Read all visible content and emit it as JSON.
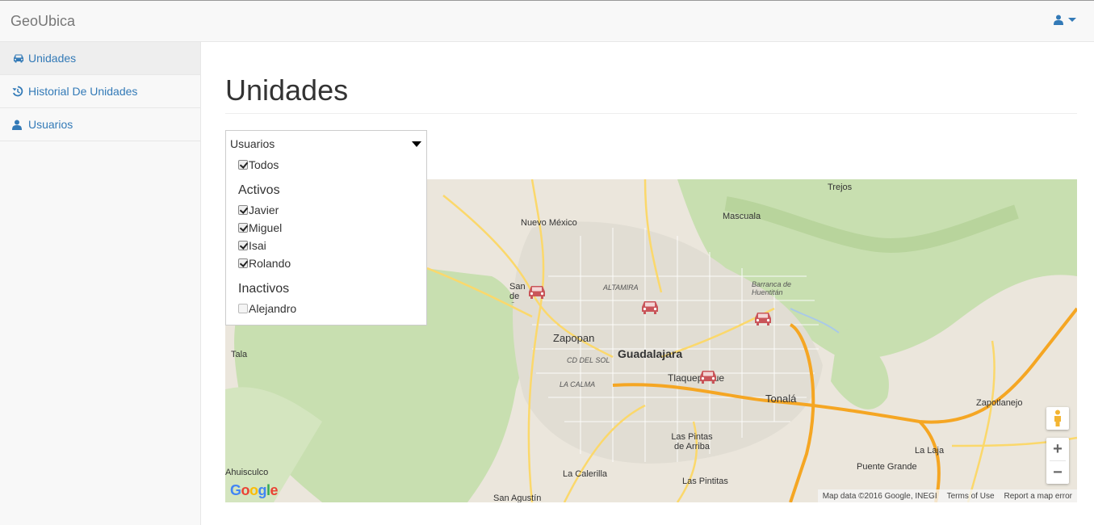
{
  "app": {
    "brand": "GeoUbica"
  },
  "sidebar": {
    "items": [
      {
        "label": "Unidades",
        "icon": "car-icon",
        "active": true
      },
      {
        "label": "Historial De Unidades",
        "icon": "history-icon",
        "active": false
      },
      {
        "label": "Usuarios",
        "icon": "user-icon",
        "active": false
      }
    ]
  },
  "page": {
    "title": "Unidades"
  },
  "filter": {
    "header": "Usuarios",
    "all": {
      "label": "Todos",
      "checked": true
    },
    "active_group": "Activos",
    "active_users": [
      {
        "label": "Javier",
        "checked": true
      },
      {
        "label": "Miguel",
        "checked": true
      },
      {
        "label": "Isai",
        "checked": true
      },
      {
        "label": "Rolando",
        "checked": true
      }
    ],
    "inactive_group": "Inactivos",
    "inactive_users": [
      {
        "label": "Alejandro",
        "checked": false
      }
    ]
  },
  "map": {
    "places": {
      "guadalajara": "Guadalajara",
      "zapopan": "Zapopan",
      "tonala": "Tonalá",
      "tlaquepaque": "Tlaquepaque",
      "nuevo_mexico": "Nuevo México",
      "mascuala": "Mascuala",
      "trejos": "Trejos",
      "barranca": "Barranca de Huentitán",
      "tala": "Tala",
      "ahuisculco": "Ahuisculco",
      "la_calerilla": "La Calerilla",
      "las_pintitas": "Las Pintitas",
      "las_pintas_de_arriba": "Las Pintas de Arriba",
      "san_agustin": "San Agustín",
      "puente_grande": "Puente Grande",
      "la_laja": "La Laja",
      "zapotlanejo": "Zapotlanejo",
      "cd_del_sol": "CD DEL SOL",
      "la_calma": "LA CALMA",
      "altamira": "ALTAMIRA",
      "san_cristobal": "San de C..."
    },
    "attribution": "Map data ©2016 Google, INEGI",
    "terms": "Terms of Use",
    "report": "Report a map error",
    "google_logo": "Google",
    "zoom_in": "+",
    "zoom_out": "−",
    "markers": [
      "car-marker-1",
      "car-marker-2",
      "car-marker-3",
      "car-marker-4"
    ]
  },
  "colors": {
    "link": "#337ab7",
    "marker": "#c9555a",
    "highway": "#f5a623",
    "park": "#c8dfb0"
  }
}
